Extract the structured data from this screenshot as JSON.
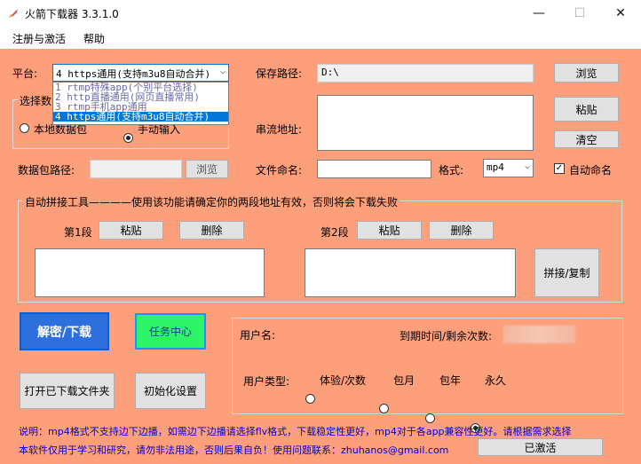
{
  "window": {
    "title": "火箭下载器  3.3.1.0",
    "minimize": "—",
    "maximize": "☐",
    "close": "✕"
  },
  "menu": {
    "items": [
      "注册与激活",
      "帮助"
    ]
  },
  "platform": {
    "label": "平台:",
    "selected": "4 https通用(支持m3u8自动合并)",
    "options": [
      "1 rtmp特殊app(个别平台选择)",
      "2 http直播通用(网页直播常用)",
      "3 rtmp手机app通用",
      "4 https通用(支持m3u8自动合并)"
    ]
  },
  "select_group": {
    "title": "选择数",
    "radio_local": "本地数据包",
    "radio_manual": "手动输入"
  },
  "save_path": {
    "label": "保存路径:",
    "value": "D:\\",
    "browse": "浏览"
  },
  "stream": {
    "label": "串流地址:",
    "paste": "粘贴",
    "clear": "清空"
  },
  "package_path": {
    "label": "数据包路径:",
    "browse": "浏览"
  },
  "file_name": {
    "label": "文件命名:",
    "value": ""
  },
  "format": {
    "label": "格式:",
    "value": "mp4"
  },
  "auto_name": {
    "label": "自动命名",
    "checked": true
  },
  "concat": {
    "title": "自动拼接工具————使用该功能请确定你的两段地址有效，否则将会下载失败",
    "seg1": "第1段",
    "seg2": "第2段",
    "paste": "粘贴",
    "delete": "删除",
    "concat_copy": "拼接/复制"
  },
  "actions": {
    "download": "解密/下载",
    "task_center": "任务中心",
    "open_folder": "打开已下载文件夹",
    "init_settings": "初始化设置"
  },
  "user": {
    "name_label": "用户名:",
    "expiry_label": "到期时间/剩余次数:",
    "type_label": "用户类型:",
    "types": [
      "体验/次数",
      "包月",
      "包年",
      "永久"
    ],
    "selected_type": "永久"
  },
  "notice": {
    "line1": "说明：mp4格式不支持边下边播，如需边下边播请选择flv格式，下载稳定性更好，mp4对于各app兼容性更好。请根据需求选择",
    "line2": "本软件仅用于学习和研究，请勿非法用途，否则后果自负！使用问题联系：zhuhanos@gmail.com",
    "activated": "已激活"
  }
}
